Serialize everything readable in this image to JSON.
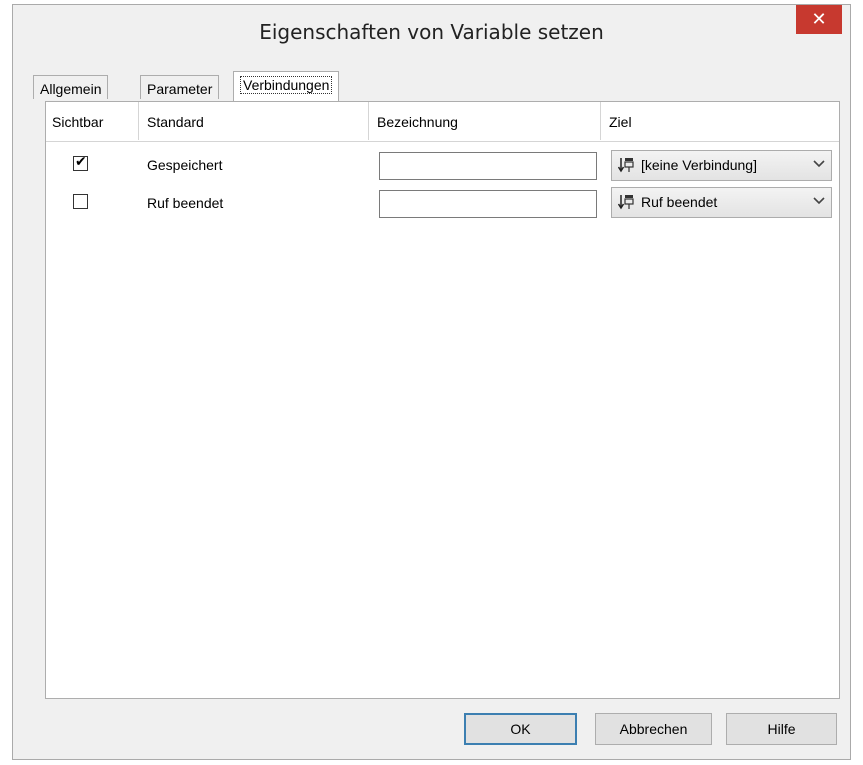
{
  "dialog": {
    "title": "Eigenschaften von Variable setzen",
    "close_label": "✕"
  },
  "tabs": [
    {
      "label": "Allgemein",
      "active": false
    },
    {
      "label": "Parameter",
      "active": false
    },
    {
      "label": "Verbindungen",
      "active": true
    }
  ],
  "table": {
    "columns": [
      "Sichtbar",
      "Standard",
      "Bezeichnung",
      "Ziel"
    ],
    "rows": [
      {
        "visible": true,
        "standard": "Gespeichert",
        "bezeichnung": "",
        "ziel": "[keine Verbindung]"
      },
      {
        "visible": false,
        "standard": "Ruf beendet",
        "bezeichnung": "",
        "ziel": "Ruf beendet"
      }
    ]
  },
  "buttons": {
    "ok": "OK",
    "cancel": "Abbrechen",
    "help": "Hilfe"
  },
  "colors": {
    "close_button": "#c7392f",
    "default_button_border": "#3c7fb1"
  },
  "icons": {
    "connection_target": "connection-arrow-icon",
    "dropdown": "chevron-down-icon"
  }
}
